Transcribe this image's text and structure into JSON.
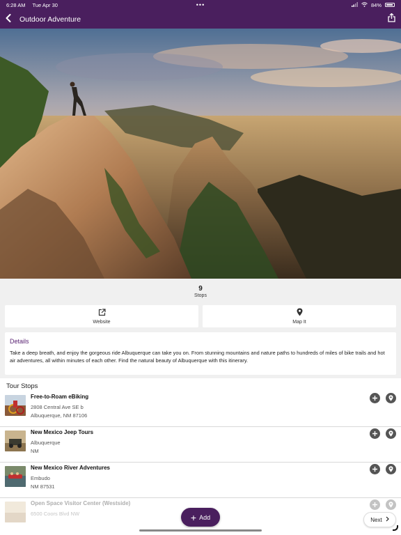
{
  "status": {
    "time": "6:28 AM",
    "date": "Tue Apr 30",
    "battery": "84%",
    "dots": "•••"
  },
  "nav": {
    "title": "Outdoor Adventure"
  },
  "summary": {
    "count": "9",
    "label": "Stops"
  },
  "actions": {
    "website": "Website",
    "map_it": "Map It"
  },
  "details": {
    "title": "Details",
    "text": "Take a deep breath, and enjoy the gorgeous ride Albuquerque can take you on. From stunning mountains and nature paths to hundreds of miles of bike trails and hot air adventures, all within minutes of each other. Find the natural beauty of Albuquerque with this itinerary."
  },
  "tour_stops": {
    "title": "Tour Stops",
    "items": [
      {
        "name": "Free-to-Roam eBiking",
        "line1": "2808 Central Ave SE b",
        "line2": "Albuquerque, NM 87106"
      },
      {
        "name": "New Mexico Jeep Tours",
        "line1": "Albuquerque",
        "line2": "NM"
      },
      {
        "name": "New Mexico River Adventures",
        "line1": "Embudo",
        "line2": "NM 87531"
      },
      {
        "name": "Open Space Visitor Center (Westside)",
        "line1": "6500 Coors Blvd NW",
        "line2": ""
      }
    ]
  },
  "buttons": {
    "add": "Add",
    "next": "Next"
  },
  "colors": {
    "brand": "#4a1f5e",
    "accent": "#5a2373"
  }
}
